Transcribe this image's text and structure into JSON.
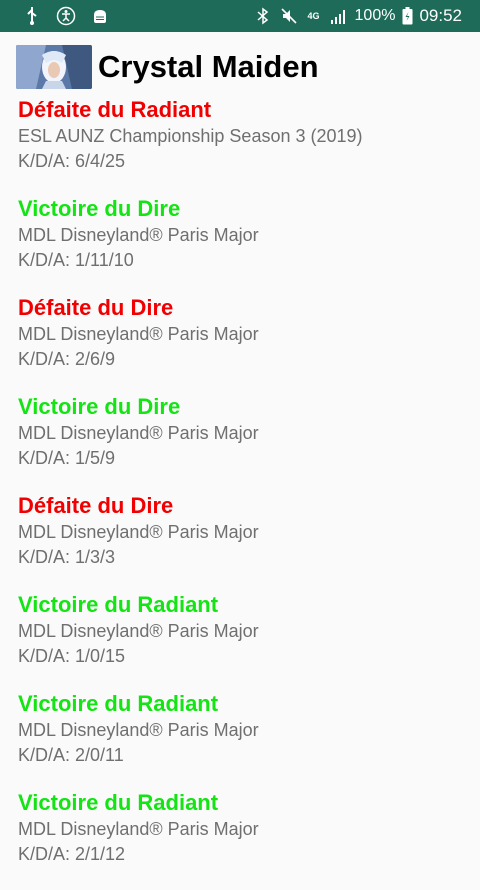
{
  "status_bar": {
    "battery": "100%",
    "time": "09:52",
    "network": "4G",
    "icons_left": [
      "usb-icon",
      "accessibility-icon",
      "android-debug-icon"
    ],
    "icons_right": [
      "bluetooth-icon",
      "mute-icon",
      "signal-icon",
      "battery-icon"
    ]
  },
  "header": {
    "title": "Crystal Maiden"
  },
  "matches": [
    {
      "result": "Défaite du Radiant",
      "event": "ESL AUNZ Championship Season 3 (2019)",
      "kda": "K/D/A: 6/4/25",
      "outcome": "loss"
    },
    {
      "result": "Victoire du Dire",
      "event": "MDL Disneyland® Paris Major",
      "kda": "K/D/A: 1/11/10",
      "outcome": "win"
    },
    {
      "result": "Défaite du Dire",
      "event": "MDL Disneyland® Paris Major",
      "kda": "K/D/A: 2/6/9",
      "outcome": "loss"
    },
    {
      "result": "Victoire du Dire",
      "event": "MDL Disneyland® Paris Major",
      "kda": "K/D/A: 1/5/9",
      "outcome": "win"
    },
    {
      "result": "Défaite du Dire",
      "event": "MDL Disneyland® Paris Major",
      "kda": "K/D/A: 1/3/3",
      "outcome": "loss"
    },
    {
      "result": "Victoire du Radiant",
      "event": "MDL Disneyland® Paris Major",
      "kda": "K/D/A: 1/0/15",
      "outcome": "win"
    },
    {
      "result": "Victoire du Radiant",
      "event": "MDL Disneyland® Paris Major",
      "kda": "K/D/A: 2/0/11",
      "outcome": "win"
    },
    {
      "result": "Victoire du Radiant",
      "event": "MDL Disneyland® Paris Major",
      "kda": "K/D/A: 2/1/12",
      "outcome": "win"
    }
  ],
  "colors": {
    "win": "#14e414",
    "loss": "#f00000",
    "status_bar": "#1f6b5a"
  }
}
